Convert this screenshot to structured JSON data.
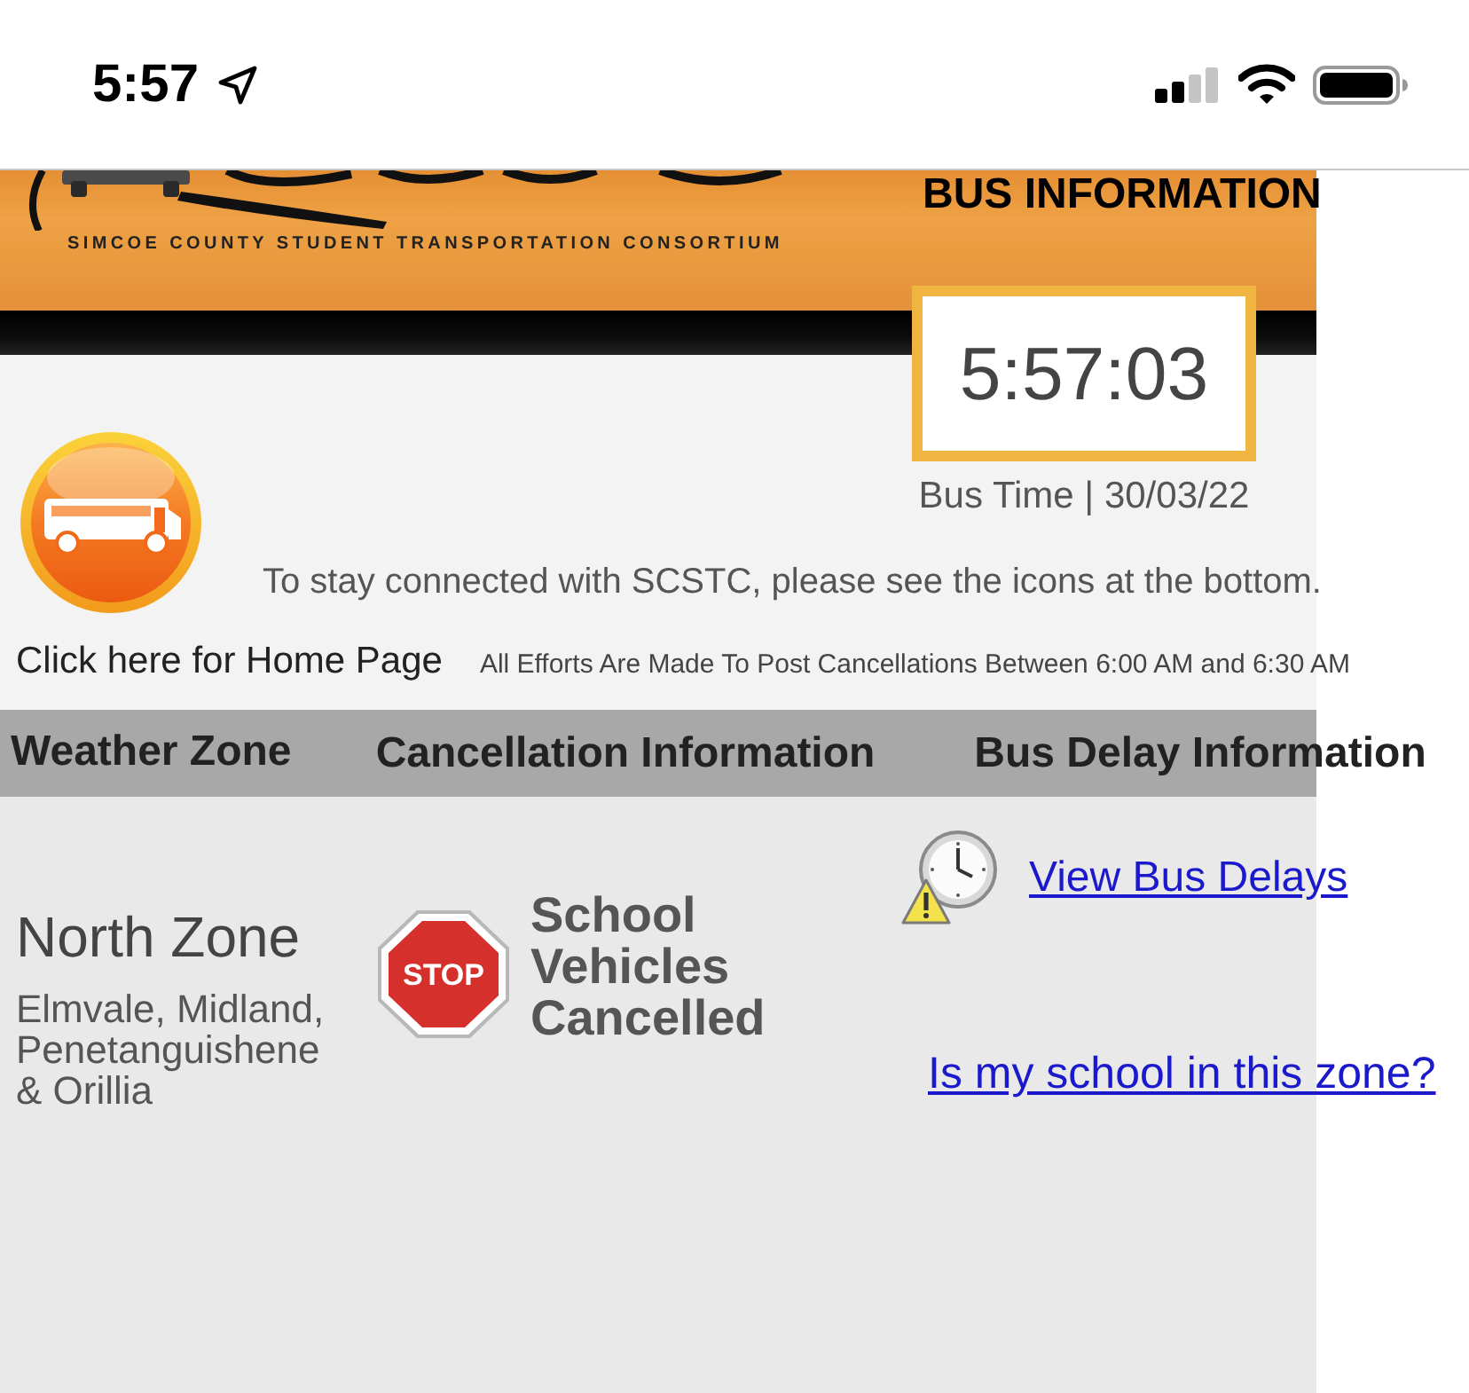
{
  "status_bar": {
    "time": "5:57"
  },
  "banner": {
    "tagline": "SIMCOE COUNTY STUDENT TRANSPORTATION CONSORTIUM",
    "title": "BUS INFORMATION"
  },
  "clock": {
    "time": "5:57:03",
    "caption": "Bus Time | 30/03/22"
  },
  "notice": "To stay connected with SCSTC, please see the icons at the bottom.",
  "home_link": "Click here for Home Page",
  "posting_note": "All Efforts Are Made To Post Cancellations Between 6:00 AM and 6:30 AM",
  "table": {
    "columns": [
      "Weather Zone",
      "Cancellation Information",
      "Bus Delay Information"
    ],
    "rows": [
      {
        "zone": "North Zone",
        "areas": "Elmvale, Midland, Penetanguishene & Orillia",
        "status": {
          "kind": "cancelled",
          "sign": "STOP",
          "text": "School Vehicles Cancelled"
        },
        "delays_link": "View Bus Delays",
        "zone_link": "Is my school in this zone?"
      }
    ]
  }
}
